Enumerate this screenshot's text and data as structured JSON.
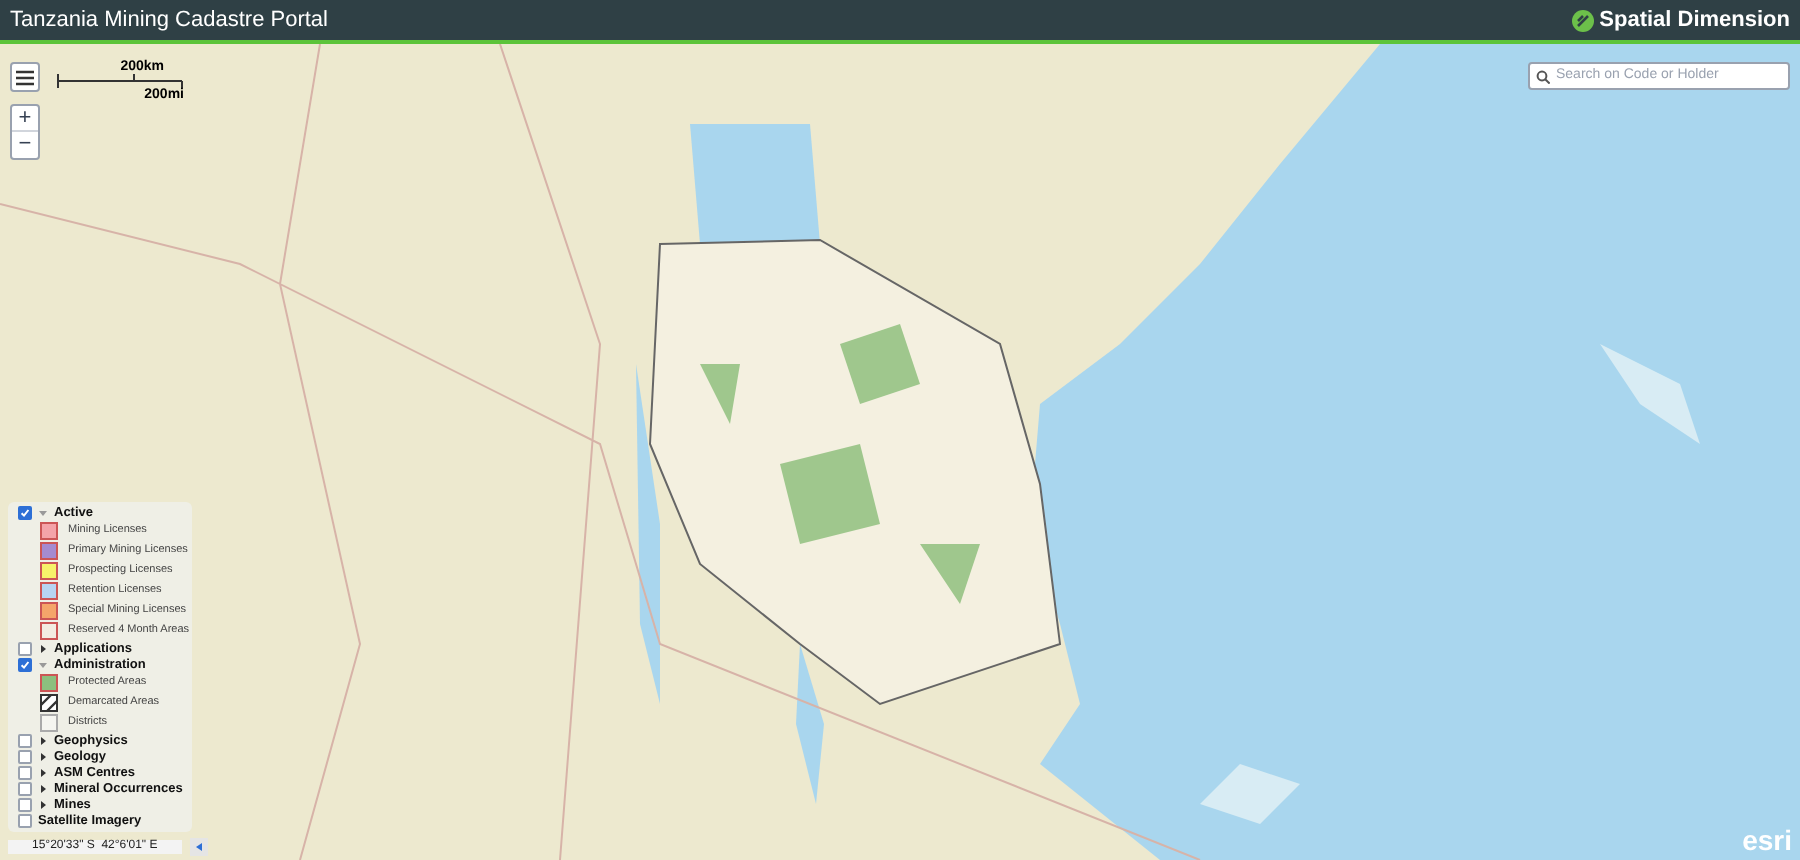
{
  "header": {
    "title": "Tanzania Mining Cadastre Portal",
    "brand": "Spatial Dimension"
  },
  "scale_bar": {
    "top": "200km",
    "bottom": "200mi"
  },
  "search": {
    "placeholder": "Search on Code or Holder"
  },
  "zoom": {
    "in": "+",
    "out": "−"
  },
  "legend": [
    {
      "kind": "group",
      "label": "Active",
      "checked": true,
      "expanded": true,
      "items": [
        {
          "kind": "fill",
          "label": "Mining Licenses",
          "color": "#f4a3a8"
        },
        {
          "kind": "fill",
          "label": "Primary Mining Licenses",
          "color": "#a58bd0"
        },
        {
          "kind": "fill",
          "label": "Prospecting Licenses",
          "color": "#f7f26a"
        },
        {
          "kind": "fill",
          "label": "Retention Licenses",
          "color": "#b7d4f2"
        },
        {
          "kind": "fill",
          "label": "Special Mining Licenses",
          "color": "#f5a56a"
        },
        {
          "kind": "fill",
          "label": "Reserved 4 Month Areas",
          "color": "#f3ece1"
        }
      ]
    },
    {
      "kind": "group",
      "label": "Applications",
      "checked": false,
      "expanded": false
    },
    {
      "kind": "group",
      "label": "Administration",
      "checked": true,
      "expanded": true,
      "items": [
        {
          "kind": "fill",
          "label": "Protected Areas",
          "color": "#8cbf7e"
        },
        {
          "kind": "hatch",
          "label": "Demarcated Areas",
          "color": "#333333"
        },
        {
          "kind": "outline",
          "label": "Districts",
          "color": "#aaaaaa"
        }
      ]
    },
    {
      "kind": "group",
      "label": "Geophysics",
      "checked": false,
      "expanded": false
    },
    {
      "kind": "group",
      "label": "Geology",
      "checked": false,
      "expanded": false
    },
    {
      "kind": "group",
      "label": "ASM Centres",
      "checked": false,
      "expanded": false
    },
    {
      "kind": "group",
      "label": "Mineral Occurrences",
      "checked": false,
      "expanded": false
    },
    {
      "kind": "group",
      "label": "Mines",
      "checked": false,
      "expanded": false
    },
    {
      "kind": "layer",
      "label": "Satellite Imagery",
      "checked": false
    }
  ],
  "coordinates": "15°20'33\" S  42°6'01\" E",
  "attribution": "esri"
}
